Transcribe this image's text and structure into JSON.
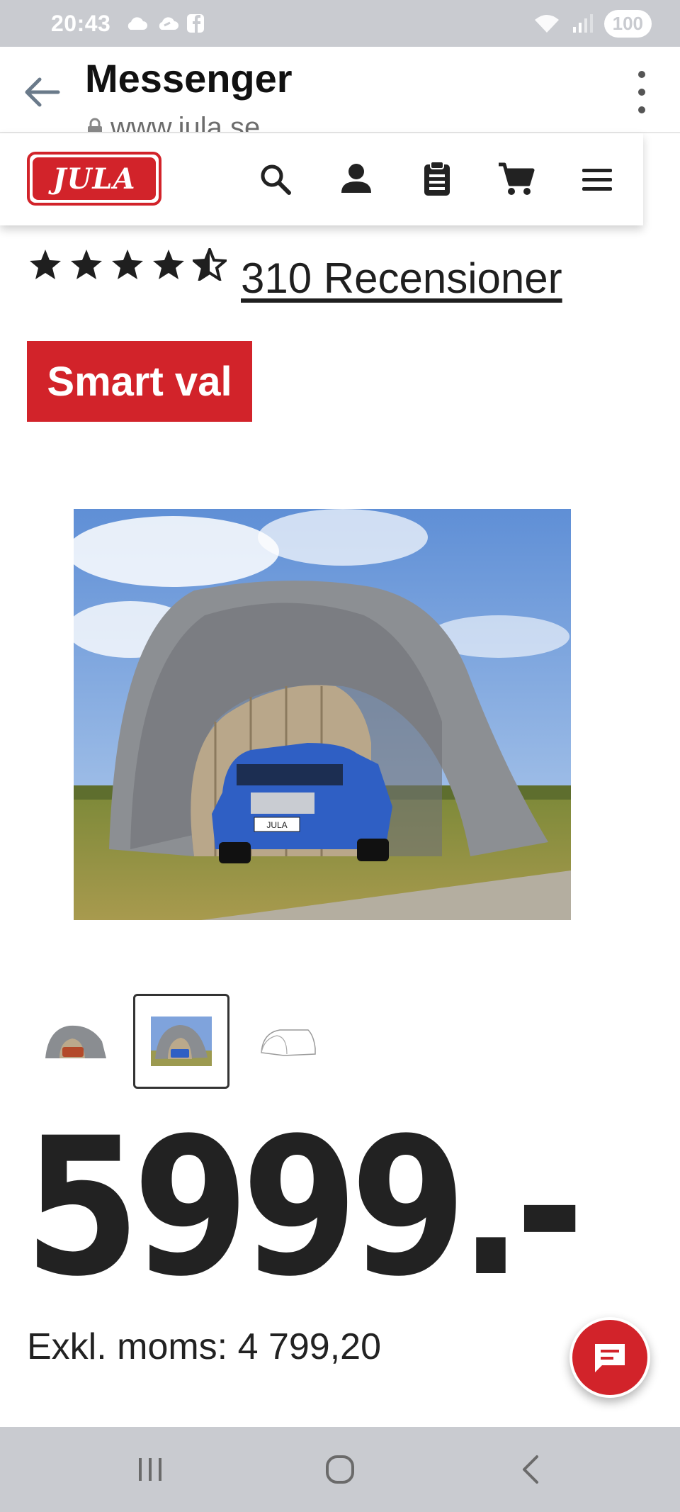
{
  "status_bar": {
    "time": "20:43",
    "battery": "100"
  },
  "browser_bar": {
    "title": "Messenger",
    "url": "www.jula.se"
  },
  "site_header": {
    "logo_text": "JULA",
    "icons": [
      "search-icon",
      "account-icon",
      "clipboard-icon",
      "cart-icon",
      "menu-icon"
    ]
  },
  "product": {
    "rating": 4.5,
    "reviews_label": "310 Recensioner",
    "badge": "Smart val",
    "plate_text": "JULA",
    "price": "5999.-",
    "price_excl_vat": "Exkl. moms: 4 799,20",
    "thumbnails_count": 3,
    "selected_thumbnail": 2
  },
  "colors": {
    "brand_red": "#d2232a",
    "system_bar": "#c9cbd0",
    "text": "#1f1f1f"
  }
}
